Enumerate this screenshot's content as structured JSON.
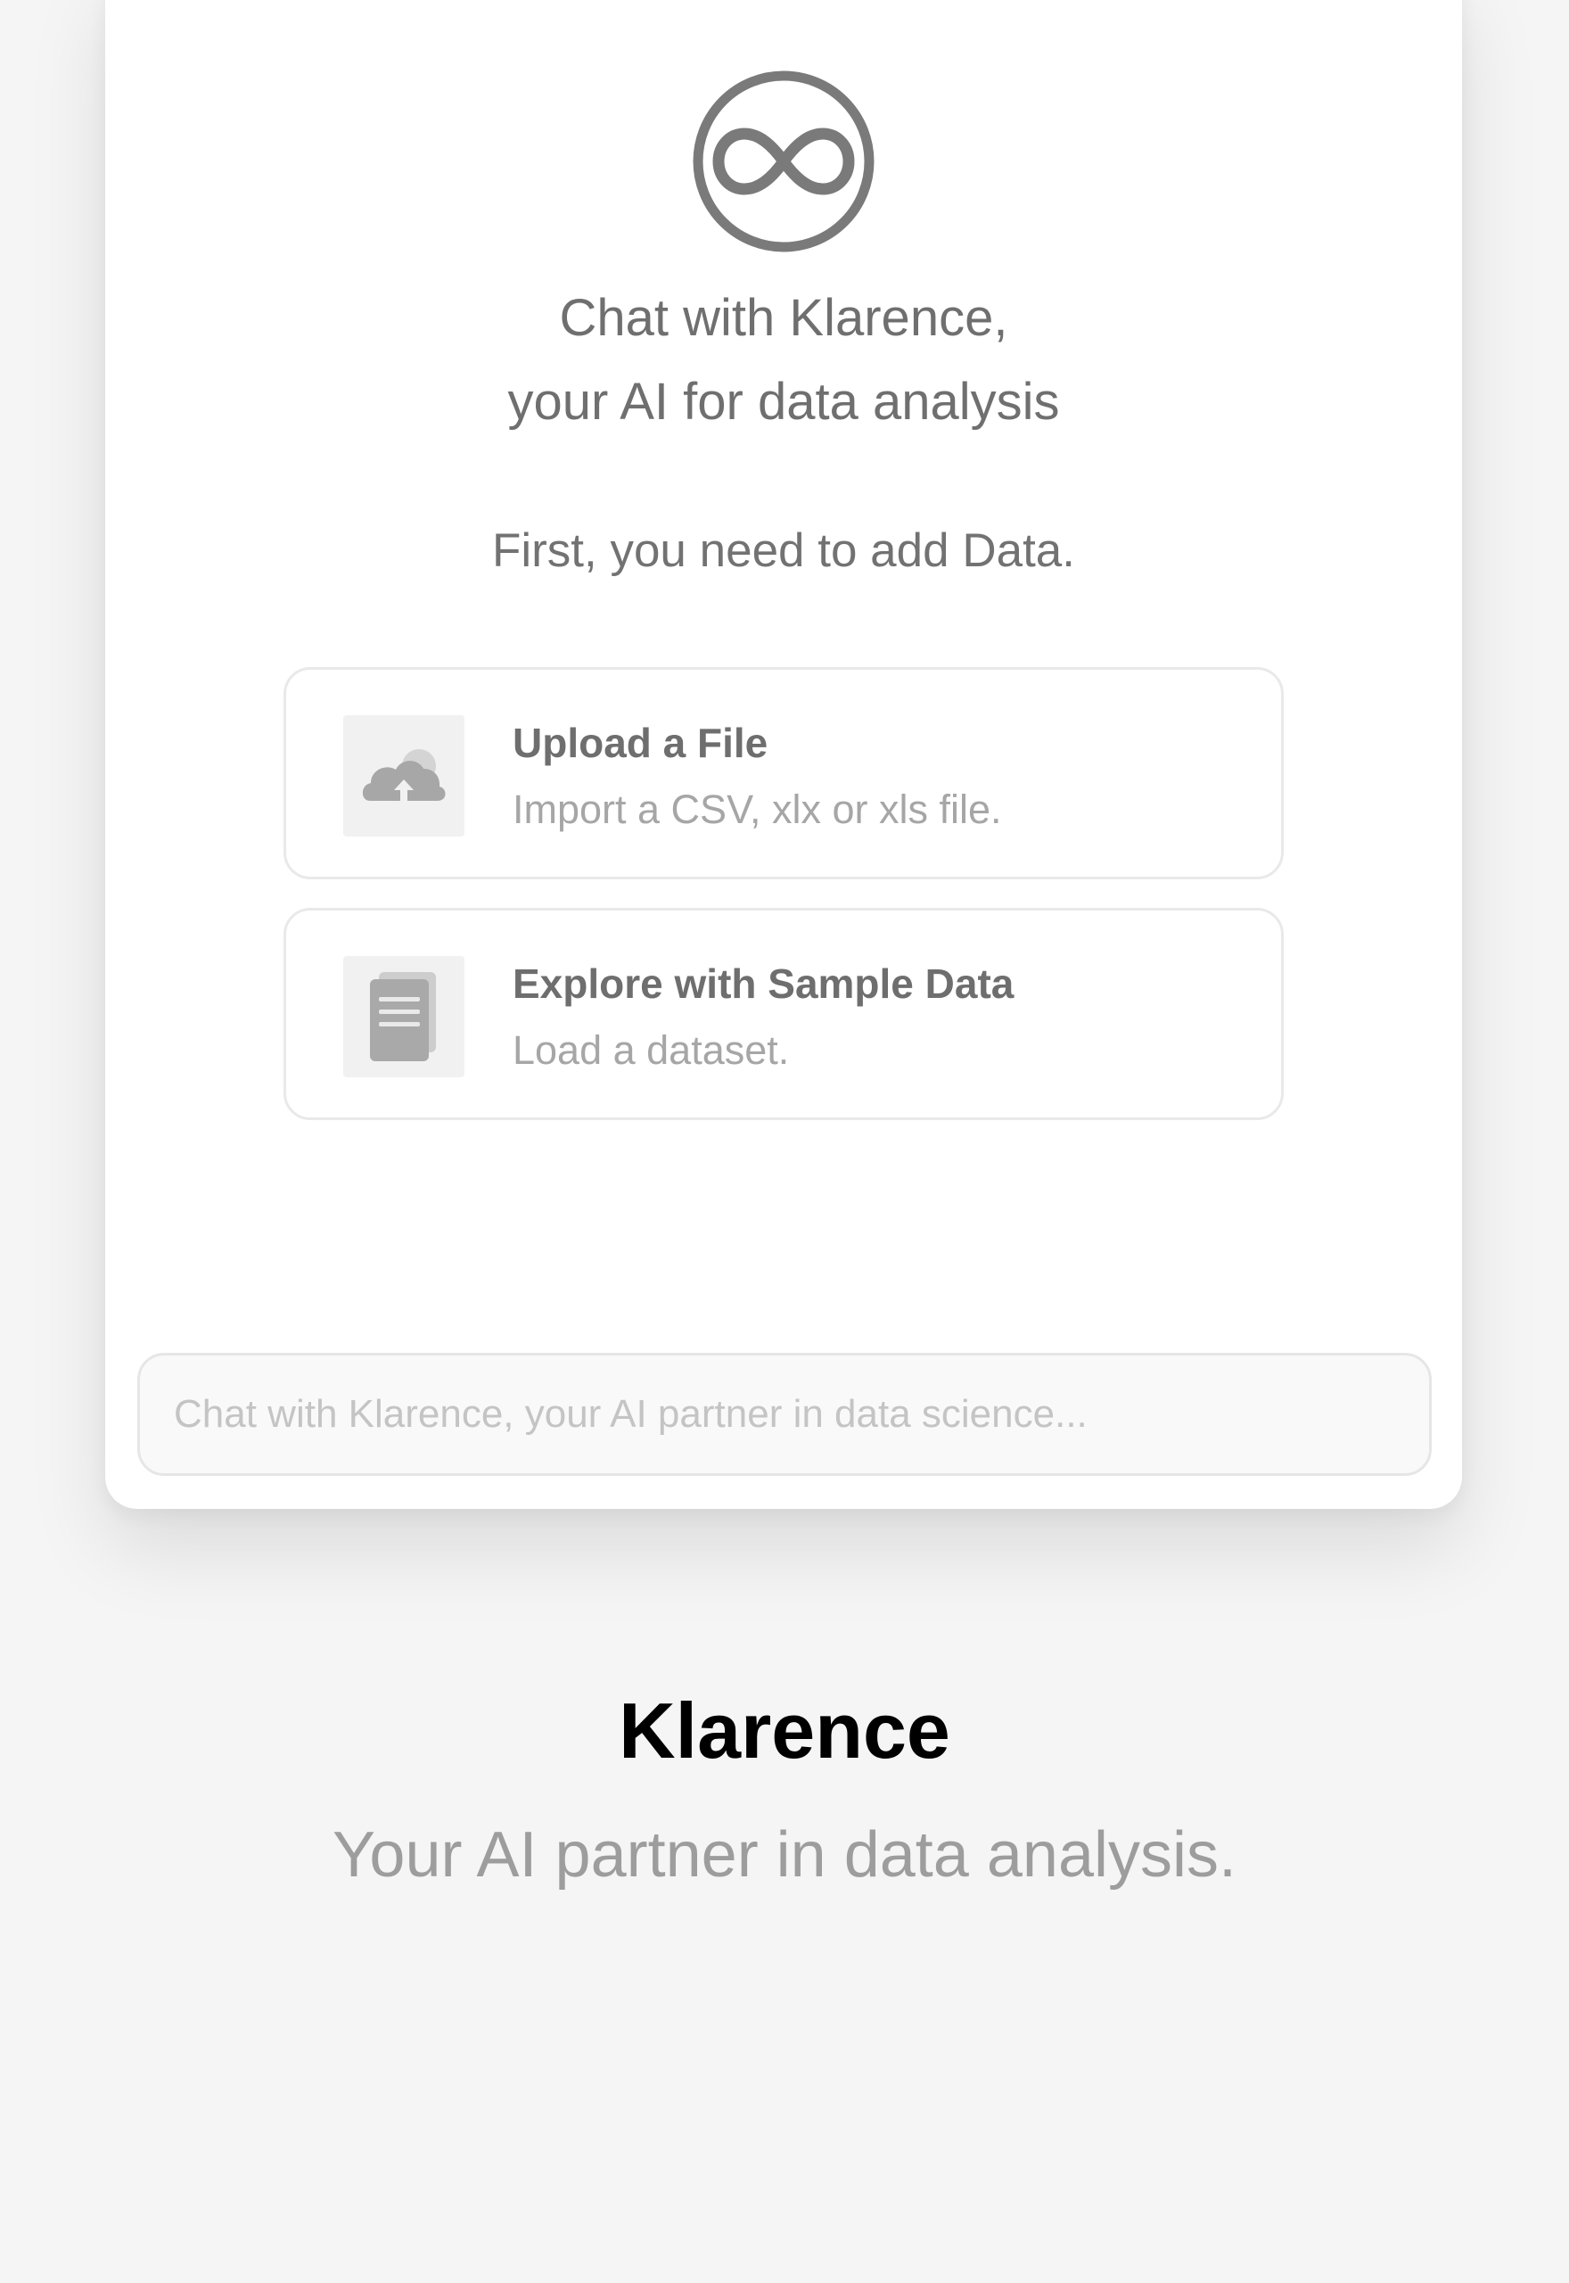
{
  "chat_card": {
    "logo_icon": "infinity-circle-icon",
    "headline_line1": "Chat with Klarence,",
    "headline_line2": "your AI for data analysis",
    "subhead": "First, you need to add Data.",
    "options": [
      {
        "icon": "cloud-upload-icon",
        "title": "Upload a File",
        "description": "Import a CSV, xlx or xls file."
      },
      {
        "icon": "document-icon",
        "title": "Explore with Sample Data",
        "description": "Load a dataset."
      }
    ],
    "input_placeholder": "Chat with Klarence, your AI partner in data science..."
  },
  "footer": {
    "brand": "Klarence",
    "tagline": "Your AI partner in data analysis."
  },
  "colors": {
    "background": "#f5f5f5",
    "card": "#ffffff",
    "icon_gray": "#7a7a7a",
    "text_gray": "#6f6f6f",
    "muted_text": "#a6a6a6",
    "brand_text": "#000000"
  }
}
